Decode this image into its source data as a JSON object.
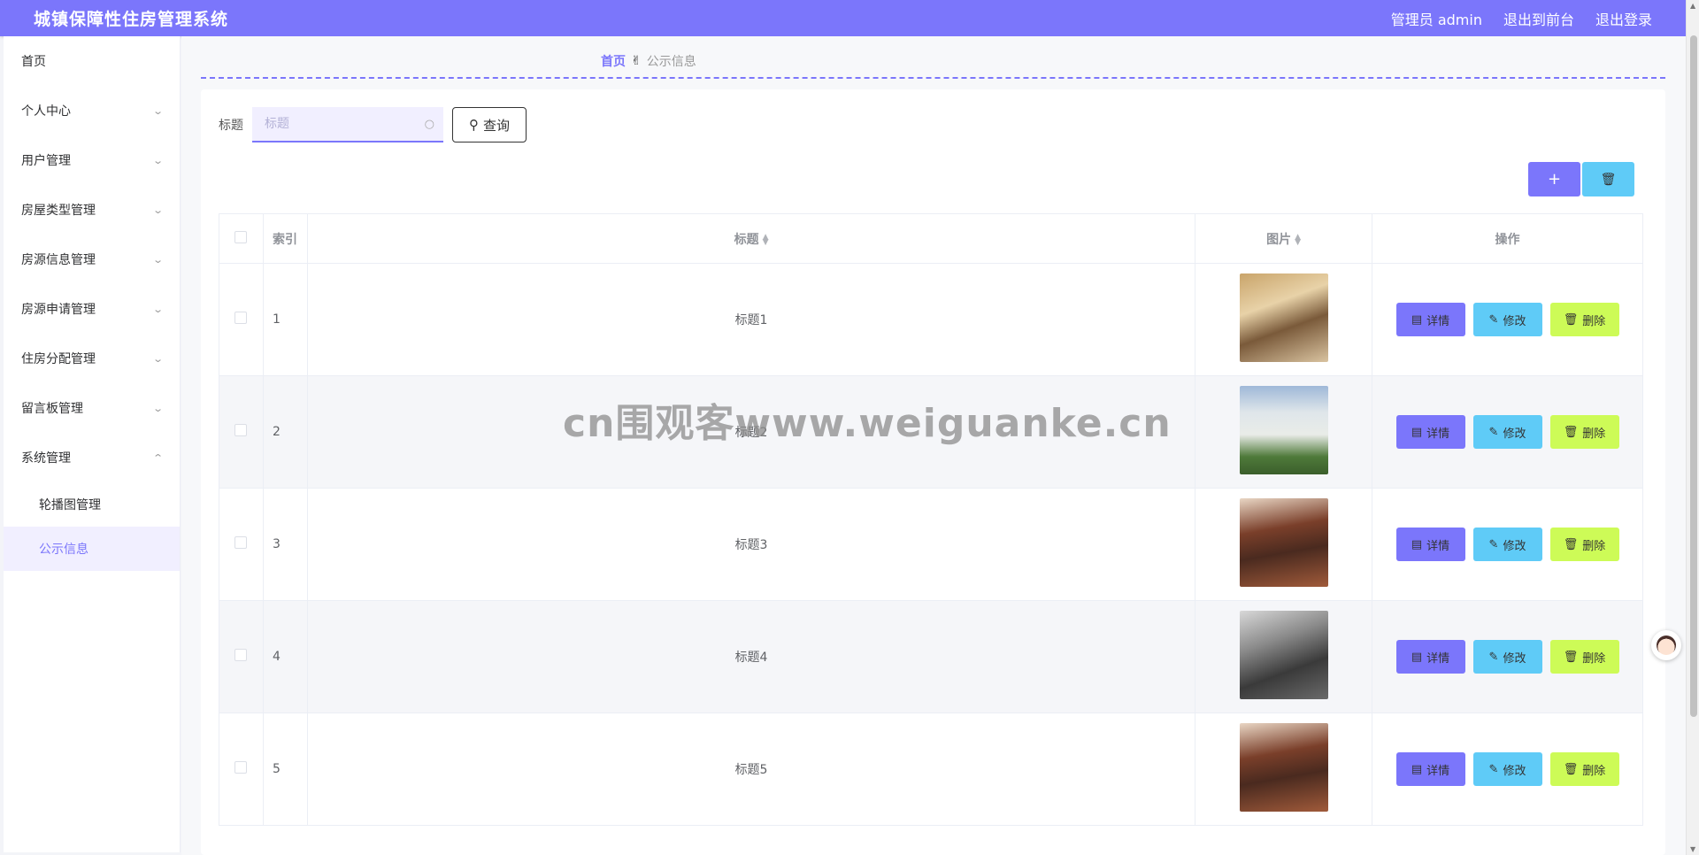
{
  "header": {
    "app_title": "城镇保障性住房管理系统",
    "admin_label": "管理员 admin",
    "front_label": "退出到前台",
    "logout_label": "退出登录"
  },
  "sidebar": {
    "items": [
      {
        "label": "首页"
      },
      {
        "label": "个人中心"
      },
      {
        "label": "用户管理"
      },
      {
        "label": "房屋类型管理"
      },
      {
        "label": "房源信息管理"
      },
      {
        "label": "房源申请管理"
      },
      {
        "label": "住房分配管理"
      },
      {
        "label": "留言板管理"
      },
      {
        "label": "系统管理"
      }
    ],
    "sub_items": [
      {
        "label": "轮播图管理"
      },
      {
        "label": "公示信息"
      }
    ]
  },
  "breadcrumb": {
    "home": "首页",
    "current": "公示信息"
  },
  "search": {
    "label": "标题",
    "placeholder": "标题",
    "query_label": "查询"
  },
  "toolbar": {
    "add_symbol": "+",
    "delete_symbol": "🗑"
  },
  "table": {
    "headers": {
      "index": "索引",
      "title": "标题",
      "image": "图片",
      "actions": "操作"
    },
    "action_labels": {
      "detail": "详情",
      "edit": "修改",
      "delete": "删除"
    },
    "rows": [
      {
        "index": "1",
        "title": "标题1"
      },
      {
        "index": "2",
        "title": "标题2"
      },
      {
        "index": "3",
        "title": "标题3"
      },
      {
        "index": "4",
        "title": "标题4"
      },
      {
        "index": "5",
        "title": "标题5"
      }
    ]
  },
  "watermark": "cn围观客www.weiguanke.cn",
  "colors": {
    "accent": "#7b76fb",
    "edit": "#5fcbf7",
    "delete": "#cdfb57"
  }
}
